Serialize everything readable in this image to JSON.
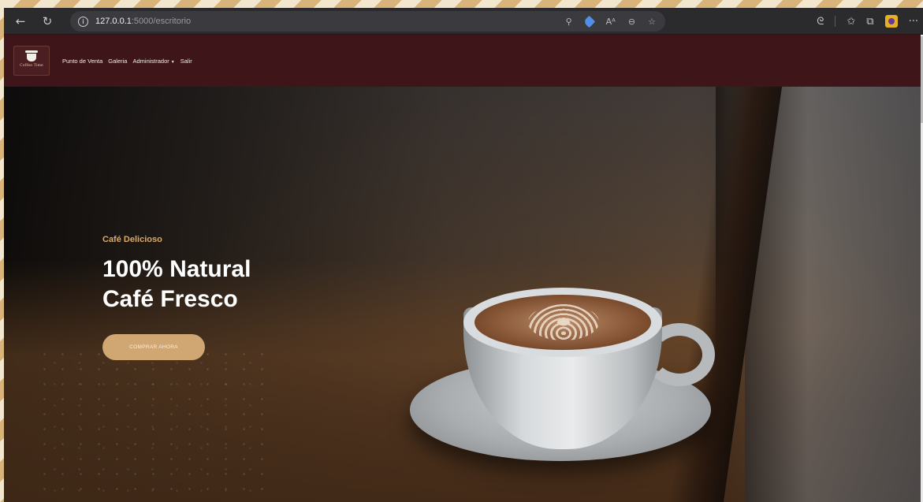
{
  "browser": {
    "address_host": "127.0.0.1",
    "address_path": ":5000/escritorio",
    "icons": {
      "back": "arrow-left-icon",
      "refresh": "refresh-icon",
      "site_info": "info-icon",
      "search": "search-icon",
      "extension": "tag-icon",
      "read_aloud": "read-aloud-icon",
      "zoom": "zoom-icon",
      "favorite": "star-add-icon",
      "copilot": "copilot-icon",
      "favorites": "favorites-icon",
      "collections": "collections-icon",
      "extension_app": "extension-icon",
      "more": "more-icon"
    }
  },
  "site": {
    "logo_text": "Coffee Time",
    "nav": {
      "items": [
        {
          "label": "Punto de Venta"
        },
        {
          "label": "Galeria"
        },
        {
          "label": "Administrador"
        },
        {
          "label": "Salir"
        }
      ]
    },
    "hero": {
      "eyebrow": "Café Delicioso",
      "title": "100% Natural\nCafé Fresco",
      "cta": "COMPRAR AHORA"
    }
  },
  "colors": {
    "nav_background": "#3e161a",
    "accent": "#d0a772",
    "eyebrow": "#d9a86b"
  }
}
